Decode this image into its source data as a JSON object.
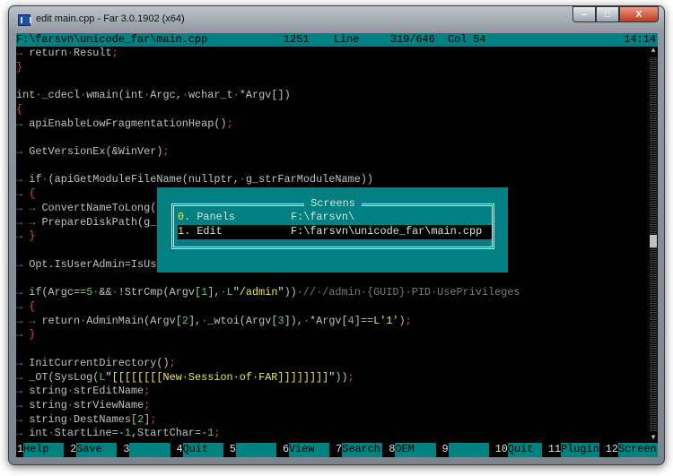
{
  "window": {
    "title": "edit main.cpp - Far 3.0.1902 (x64)",
    "min": "–",
    "max": "□",
    "close": "X"
  },
  "status": {
    "file": "F:\\farsvn\\unicode_far\\main.cpp",
    "code": "1251",
    "line_label": "Line",
    "position": "319/646",
    "col": "Col 54",
    "time": "14:14"
  },
  "code_lines": [
    [
      [
        "→ ",
        "d"
      ],
      [
        "return",
        "n"
      ],
      [
        "·",
        "d"
      ],
      [
        "Result",
        "n"
      ],
      [
        ";",
        "p"
      ]
    ],
    [
      [
        "}",
        "p"
      ]
    ],
    [],
    [
      [
        "int",
        "n"
      ],
      [
        "·",
        "d"
      ],
      [
        "_cdecl",
        "n"
      ],
      [
        "·",
        "d"
      ],
      [
        "wmain(int",
        "n"
      ],
      [
        "·",
        "d"
      ],
      [
        "Argc,",
        "n"
      ],
      [
        "·",
        "d"
      ],
      [
        "wchar_t",
        "n"
      ],
      [
        "·",
        "d"
      ],
      [
        "*Argv[])",
        "n"
      ]
    ],
    [
      [
        "{",
        "p"
      ]
    ],
    [
      [
        "→ ",
        "d"
      ],
      [
        "apiEnableLowFragmentationHeap()",
        "n"
      ],
      [
        ";",
        "p"
      ]
    ],
    [],
    [
      [
        "→ ",
        "d"
      ],
      [
        "GetVersionEx(&WinVer)",
        "n"
      ],
      [
        ";",
        "p"
      ]
    ],
    [],
    [
      [
        "→ ",
        "d"
      ],
      [
        "if",
        "n"
      ],
      [
        "·",
        "d"
      ],
      [
        "(apiGetModuleFileName(nullptr,",
        "n"
      ],
      [
        "·",
        "d"
      ],
      [
        "g_strFarModuleName))",
        "n"
      ]
    ],
    [
      [
        "→ ",
        "d"
      ],
      [
        "{",
        "p"
      ]
    ],
    [
      [
        "→ → ",
        "d"
      ],
      [
        "ConvertNameToLong(",
        "n"
      ]
    ],
    [
      [
        "→ → ",
        "d"
      ],
      [
        "PrepareDiskPath(g_",
        "n"
      ]
    ],
    [
      [
        "→ ",
        "d"
      ],
      [
        "}",
        "p"
      ]
    ],
    [],
    [
      [
        "→ ",
        "d"
      ],
      [
        "Opt.IsUserAdmin=IsUs",
        "n"
      ]
    ],
    [],
    [
      [
        "→ ",
        "d"
      ],
      [
        "if(Argc==",
        "n"
      ],
      [
        "5",
        "g"
      ],
      [
        "·",
        "d"
      ],
      [
        "&&",
        "n"
      ],
      [
        "·",
        "d"
      ],
      [
        "!StrCmp(Argv[",
        "n"
      ],
      [
        "1",
        "g"
      ],
      [
        "],",
        "n"
      ],
      [
        "·",
        "d"
      ],
      [
        "L",
        "g"
      ],
      [
        "\"",
        "w"
      ],
      [
        "/admin",
        "y"
      ],
      [
        "\"",
        "w"
      ],
      [
        "))",
        "n"
      ],
      [
        "·//·/admin·{GUID}·PID·UsePrivileges",
        "c"
      ]
    ],
    [
      [
        "→ ",
        "d"
      ],
      [
        "{",
        "p"
      ]
    ],
    [
      [
        "→ → ",
        "d"
      ],
      [
        "return",
        "n"
      ],
      [
        "·",
        "d"
      ],
      [
        "AdminMain(Argv[",
        "n"
      ],
      [
        "2",
        "g"
      ],
      [
        "],",
        "n"
      ],
      [
        "·",
        "d"
      ],
      [
        "_wtoi(Argv[",
        "n"
      ],
      [
        "3",
        "g"
      ],
      [
        "]),",
        "n"
      ],
      [
        "·",
        "d"
      ],
      [
        "*Argv[",
        "n"
      ],
      [
        "4",
        "g"
      ],
      [
        "]==",
        "n"
      ],
      [
        "L'1'",
        "y"
      ],
      [
        ")",
        "n"
      ],
      [
        ";",
        "p"
      ]
    ],
    [
      [
        "→ ",
        "d"
      ],
      [
        "}",
        "p"
      ]
    ],
    [],
    [
      [
        "→ ",
        "d"
      ],
      [
        "InitCurrentDirectory()",
        "n"
      ],
      [
        ";",
        "p"
      ]
    ],
    [
      [
        "→ ",
        "d"
      ],
      [
        "_OT(SysLog(",
        "n"
      ],
      [
        "L",
        "g"
      ],
      [
        "\"",
        "w"
      ],
      [
        "[[[[[[[[New·Session·of·FAR]]]]]]]]",
        "y"
      ],
      [
        "\"",
        "w"
      ],
      [
        "))",
        "n"
      ],
      [
        ";",
        "p"
      ]
    ],
    [
      [
        "→ ",
        "d"
      ],
      [
        "string",
        "n"
      ],
      [
        "·",
        "d"
      ],
      [
        "strEditName",
        "n"
      ],
      [
        ";",
        "p"
      ]
    ],
    [
      [
        "→ ",
        "d"
      ],
      [
        "string",
        "n"
      ],
      [
        "·",
        "d"
      ],
      [
        "strViewName",
        "n"
      ],
      [
        ";",
        "p"
      ]
    ],
    [
      [
        "→ ",
        "d"
      ],
      [
        "string",
        "n"
      ],
      [
        "·",
        "d"
      ],
      [
        "DestNames[",
        "n"
      ],
      [
        "2",
        "g"
      ],
      [
        "]",
        "n"
      ],
      [
        ";",
        "p"
      ]
    ],
    [
      [
        "→ ",
        "d"
      ],
      [
        "int",
        "n"
      ],
      [
        "·",
        "d"
      ],
      [
        "StartLine=-",
        "n"
      ],
      [
        "1",
        "g"
      ],
      [
        ",StartChar=-",
        "n"
      ],
      [
        "1",
        "g"
      ],
      [
        ";",
        "p"
      ]
    ]
  ],
  "scrollbar": {
    "position_fraction": 0.49,
    "up": "▲",
    "down": "▼"
  },
  "screens_dialog": {
    "title": "Screens",
    "items": [
      {
        "key": "0",
        "label": ". Panels",
        "path": "F:\\farsvn\\"
      },
      {
        "key": "1",
        "label": ". Edit",
        "path": "F:\\farsvn\\unicode_far\\main.cpp",
        "selected": true
      }
    ]
  },
  "keybar": [
    {
      "num": "1",
      "label": "Help"
    },
    {
      "num": "2",
      "label": "Save"
    },
    {
      "num": "3",
      "label": ""
    },
    {
      "num": "4",
      "label": "Quit"
    },
    {
      "num": "5",
      "label": ""
    },
    {
      "num": "6",
      "label": "View"
    },
    {
      "num": "7",
      "label": "Search"
    },
    {
      "num": "8",
      "label": "OEM"
    },
    {
      "num": "9",
      "label": ""
    },
    {
      "num": "10",
      "label": "Quit"
    },
    {
      "num": "11",
      "label": "Plugin"
    },
    {
      "num": "12",
      "label": "Screen"
    }
  ]
}
